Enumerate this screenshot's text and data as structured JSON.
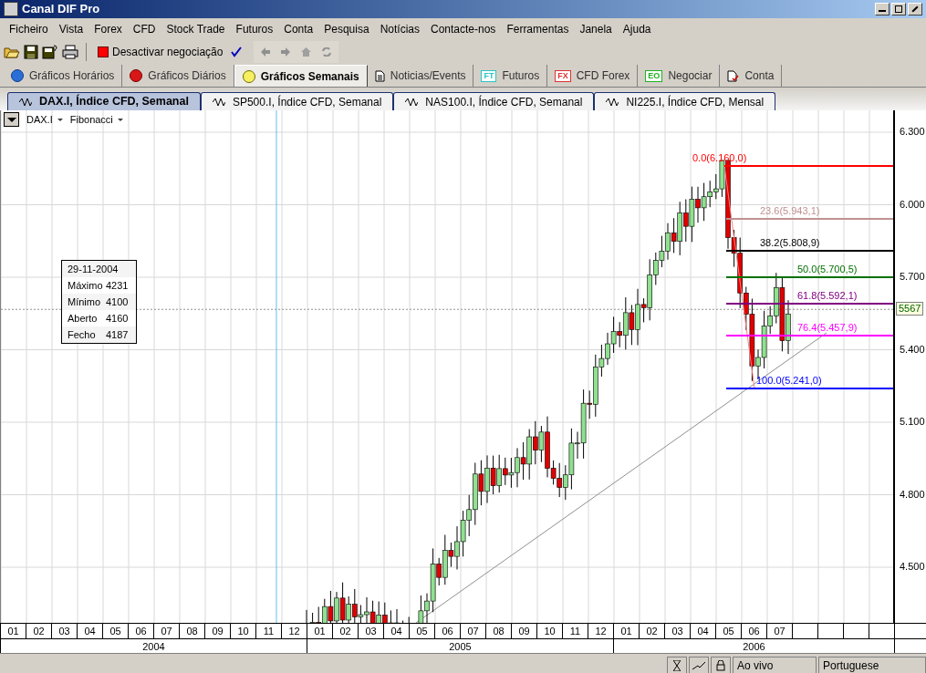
{
  "window": {
    "title": "Canal DIF Pro"
  },
  "menu": [
    "Ficheiro",
    "Vista",
    "Forex",
    "CFD",
    "Stock Trade",
    "Futuros",
    "Conta",
    "Pesquisa",
    "Notícias",
    "Contacte-nos",
    "Ferramentas",
    "Janela",
    "Ajuda"
  ],
  "toolbar": {
    "trading_button": {
      "label": "Desactivar negociação",
      "active": true
    }
  },
  "section_tabs": [
    {
      "label": "Gráficos Horários",
      "kind": "info",
      "selected": false
    },
    {
      "label": "Gráficos Diários",
      "kind": "alert",
      "selected": false
    },
    {
      "label": "Gráficos Semanais",
      "kind": "warning",
      "selected": true
    },
    {
      "label": "Noticias/Events",
      "kind": "document",
      "selected": false
    },
    {
      "label": "Futuros",
      "kind": "badge",
      "badge": "FT",
      "color": "#2cc4c4",
      "selected": false
    },
    {
      "label": "CFD Forex",
      "kind": "badge",
      "badge": "FX",
      "color": "#e03030",
      "selected": false
    },
    {
      "label": "Negociar",
      "kind": "badge",
      "badge": "EO",
      "color": "#20b020",
      "selected": false
    },
    {
      "label": "Conta",
      "kind": "checkdoc",
      "selected": false
    }
  ],
  "chart_tabs": [
    {
      "label": "DAX.I, Índice CFD, Semanal",
      "selected": true
    },
    {
      "label": "SP500.I, Índice CFD, Semanal",
      "selected": false
    },
    {
      "label": "NAS100.I, Índice CFD, Semanal",
      "selected": false
    },
    {
      "label": "NI225.I, Índice CFD, Mensal",
      "selected": false
    }
  ],
  "chart": {
    "symbol": "DAX.I",
    "study": "Fibonacci",
    "y_ticks": [
      "6.300",
      "6.000",
      "5.700",
      "5.400",
      "5.100",
      "4.800",
      "4.500"
    ],
    "current_price": "5567",
    "fibonacci": [
      {
        "label": "0.0(6.160,0)",
        "color": "#ff0000"
      },
      {
        "label": "23.6(5.943,1)",
        "color": "#c09090"
      },
      {
        "label": "38.2(5.808,9)",
        "color": "#000000"
      },
      {
        "label": "50.0(5.700,5)",
        "color": "#007000"
      },
      {
        "label": "61.8(5.592,1)",
        "color": "#800080"
      },
      {
        "label": "76.4(5.457,9)",
        "color": "#ff00ff"
      },
      {
        "label": "100.0(5.241,0)",
        "color": "#0000ff"
      }
    ],
    "tooltip": {
      "date": "29-11-2004",
      "rows": [
        {
          "label": "Máximo",
          "value": "4231"
        },
        {
          "label": "Mínimo",
          "value": "4100"
        },
        {
          "label": "Aberto",
          "value": "4160"
        },
        {
          "label": "Fecho",
          "value": "4187"
        }
      ]
    },
    "time_axis": [
      {
        "year": "2004",
        "months": [
          "01",
          "02",
          "03",
          "04",
          "05",
          "06",
          "07",
          "08",
          "09",
          "10",
          "11",
          "12"
        ]
      },
      {
        "year": "2005",
        "months": [
          "01",
          "02",
          "03",
          "04",
          "05",
          "06",
          "07",
          "08",
          "09",
          "10",
          "11",
          "12"
        ]
      },
      {
        "year": "2006",
        "months": [
          "01",
          "02",
          "03",
          "04",
          "05",
          "06",
          "07"
        ]
      }
    ]
  },
  "status_bar": {
    "mode": "Ao vivo",
    "language": "Portuguese"
  }
}
